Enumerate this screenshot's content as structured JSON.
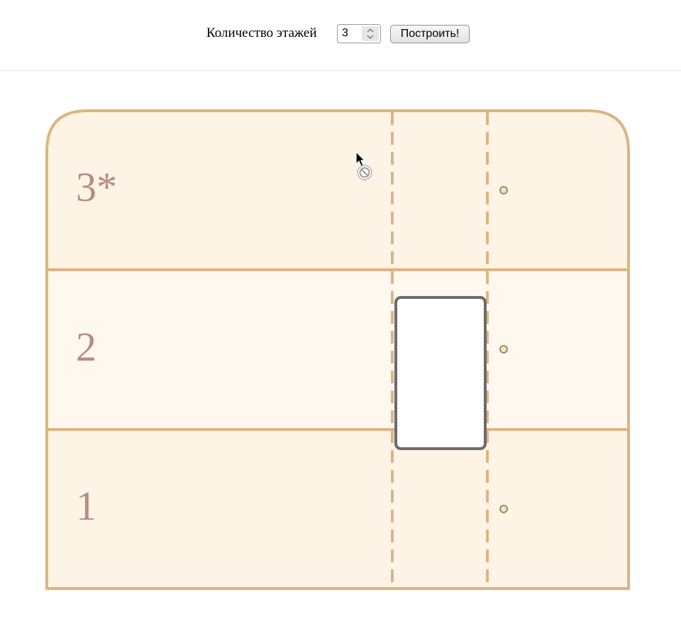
{
  "toolbar": {
    "floors_label": "Количество этажей",
    "floors_value": "3",
    "build_label": "Построить!"
  },
  "building": {
    "floors": [
      {
        "label": "3*"
      },
      {
        "label": "2"
      },
      {
        "label": "1"
      }
    ],
    "elevator_floor": "2",
    "colors": {
      "wall": "#dcb583",
      "floor_fill": "#fdf4e6",
      "label": "#b98a84",
      "elevator_border": "#6b6b6b"
    }
  },
  "cursor": {
    "state": "not-allowed-icon"
  }
}
